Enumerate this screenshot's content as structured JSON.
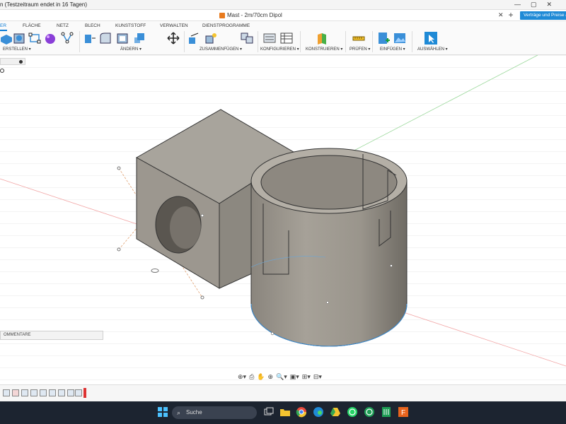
{
  "window": {
    "title": "n (Testzeitraum endet in 16 Tagen)",
    "controls": "—▢✕"
  },
  "document": {
    "tab_name": "Mast - 2m/70cm Dipol",
    "close": "✕",
    "add": "+",
    "promo_button": "Verträge und Preise an"
  },
  "ribbon": {
    "tabs": [
      "ER",
      "FLÄCHE",
      "NETZ",
      "BLECH",
      "KUNSTSTOFF",
      "VERWALTEN",
      "DIENSTPROGRAMME"
    ],
    "groups": [
      "ERSTELLEN ▾",
      "ÄNDERN ▾",
      "ZUSAMMENFÜGEN ▾",
      "KONFIGURIEREN ▾",
      "KONSTRUIEREN ▾",
      "PRÜFEN ▾",
      "EINFÜGEN ▾",
      "AUSWÄHLEN ▾"
    ]
  },
  "panels": {
    "comments_label": "OMMENTARE"
  },
  "navbar": {
    "items": [
      "⊕▾",
      "⎙",
      "✋",
      "⊕",
      "🔍▾",
      "▣▾",
      "⊞▾",
      "⊟▾"
    ]
  },
  "taskbar": {
    "search_label": "Suche",
    "search_icon": "⌕"
  },
  "colors": {
    "accent": "#0a7bd6",
    "promo": "#1f8ad6",
    "body_gray": "#8f8a82",
    "taskbar": "#1c2430"
  }
}
